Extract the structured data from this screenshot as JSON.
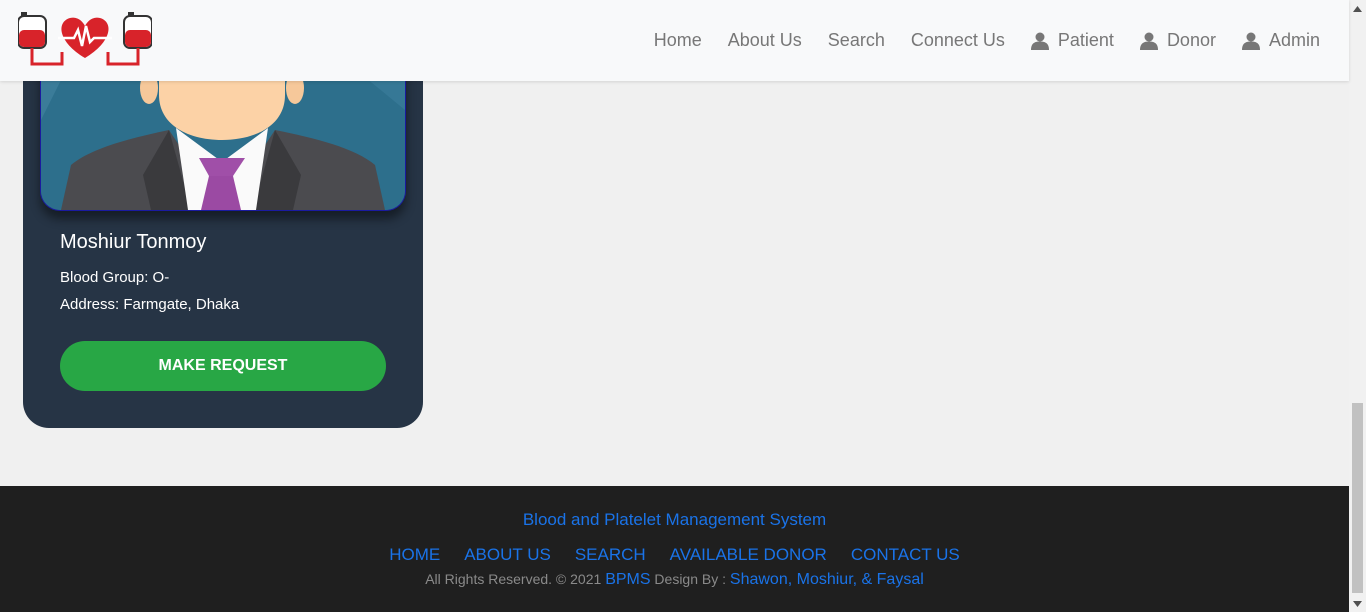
{
  "header": {
    "logo_icon": "blood-bag-heartbeat-logo",
    "nav": [
      {
        "label": "Home"
      },
      {
        "label": "About Us"
      },
      {
        "label": "Search"
      },
      {
        "label": "Connect Us"
      },
      {
        "label": "Patient",
        "icon": "user-icon"
      },
      {
        "label": "Donor",
        "icon": "user-icon"
      },
      {
        "label": "Admin",
        "icon": "user-icon"
      }
    ]
  },
  "donor_card": {
    "name": "Moshiur Tonmoy",
    "blood_group": "Blood Group: O-",
    "address": "Address: Farmgate, Dhaka",
    "button": "MAKE REQUEST"
  },
  "footer": {
    "title": "Blood and Platelet Management System",
    "links": [
      "HOME",
      "ABOUT US",
      "SEARCH",
      "AVAILABLE DONOR",
      "CONTACT US"
    ],
    "copy_prefix": "All Rights Reserved. © 2021",
    "brand": "BPMS",
    "design_by": "Design By :",
    "authors": "Shawon, Moshiur, & Faysal"
  },
  "colors": {
    "card_bg": "#263445",
    "button_green": "#28a745",
    "footer_bg": "#1f1f1f",
    "link_blue": "#1a73e8"
  }
}
